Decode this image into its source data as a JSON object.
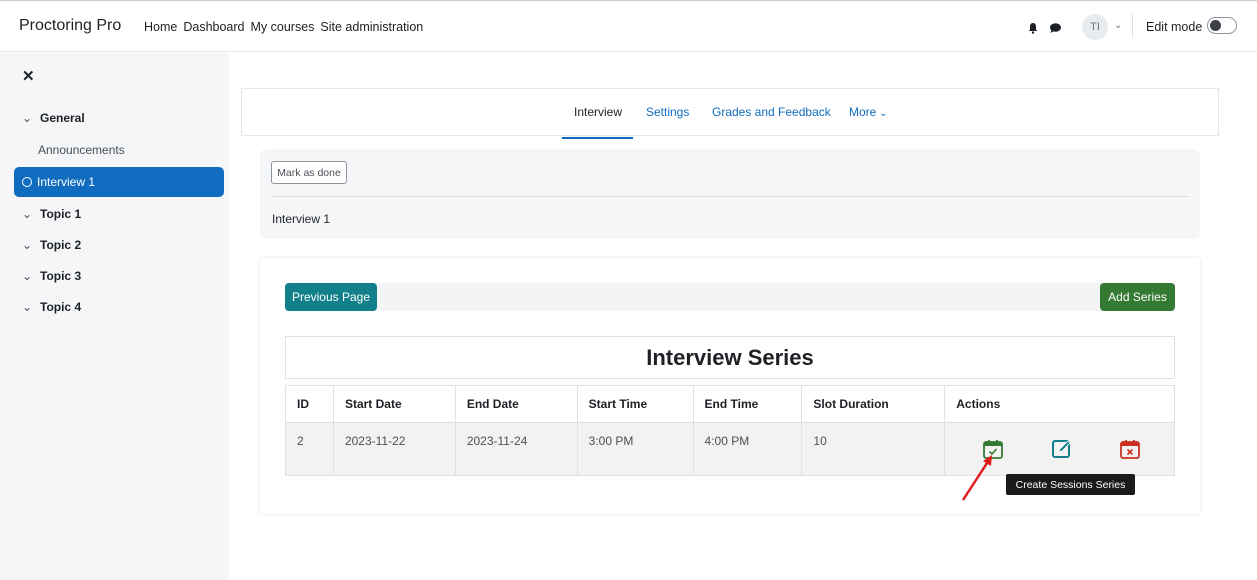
{
  "brand": "Proctoring Pro",
  "nav": [
    "Home",
    "Dashboard",
    "My courses",
    "Site administration"
  ],
  "user": {
    "initials": "TI"
  },
  "edit_mode": {
    "label": "Edit mode",
    "on": false
  },
  "sidebar": {
    "items": [
      {
        "label": "General"
      },
      {
        "label": "Announcements"
      },
      {
        "label": "Interview 1"
      },
      {
        "label": "Topic 1"
      },
      {
        "label": "Topic 2"
      },
      {
        "label": "Topic 3"
      },
      {
        "label": "Topic 4"
      }
    ]
  },
  "tabs": [
    "Interview",
    "Settings",
    "Grades and Feedback",
    "More"
  ],
  "activity": {
    "mark_done": "Mark as done",
    "name": "Interview 1"
  },
  "series": {
    "prev_label": "Previous Page",
    "add_label": "Add Series",
    "title": "Interview Series",
    "headers": [
      "ID",
      "Start Date",
      "End Date",
      "Start Time",
      "End Time",
      "Slot Duration",
      "Actions"
    ],
    "rows": [
      [
        "2",
        "2023-11-22",
        "2023-11-24",
        "3:00 PM",
        "4:00 PM",
        "10"
      ]
    ]
  },
  "tooltip": "Create Sessions Series",
  "colors": {
    "primary": "#0f6cbf",
    "teal": "#11808a",
    "green": "#357a32",
    "danger": "#ca3120"
  }
}
